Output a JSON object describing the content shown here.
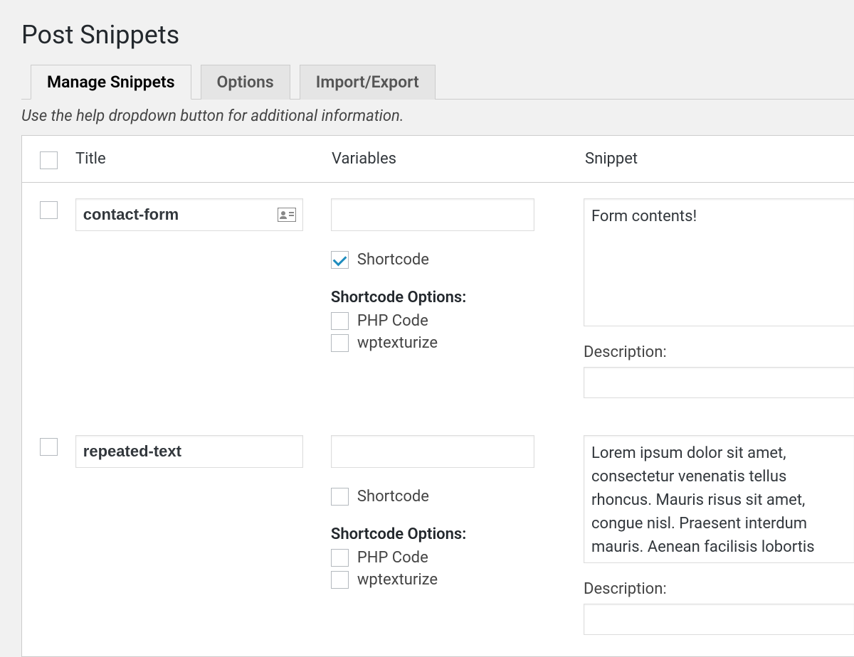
{
  "page": {
    "title": "Post Snippets",
    "help_text": "Use the help dropdown button for additional information."
  },
  "tabs": [
    {
      "label": "Manage Snippets",
      "active": true
    },
    {
      "label": "Options",
      "active": false
    },
    {
      "label": "Import/Export",
      "active": false
    }
  ],
  "columns": {
    "title": "Title",
    "variables": "Variables",
    "snippet": "Snippet"
  },
  "labels": {
    "shortcode": "Shortcode",
    "shortcode_options": "Shortcode Options:",
    "php_code": "PHP Code",
    "wptexturize": "wptexturize",
    "description": "Description:"
  },
  "rows": [
    {
      "title": "contact-form",
      "variables": "",
      "shortcode_checked": true,
      "php_code_checked": false,
      "wptexturize_checked": false,
      "snippet": "Form contents!",
      "description": ""
    },
    {
      "title": "repeated-text",
      "variables": "",
      "shortcode_checked": false,
      "php_code_checked": false,
      "wptexturize_checked": false,
      "snippet": "Lorem ipsum dolor sit amet, consectetur venenatis tellus rhoncus. Mauris risus sit amet, congue nisl. Praesent interdum mauris. Aenean facilisis lobortis odio non dolor ornare tincidunt",
      "description": ""
    }
  ]
}
